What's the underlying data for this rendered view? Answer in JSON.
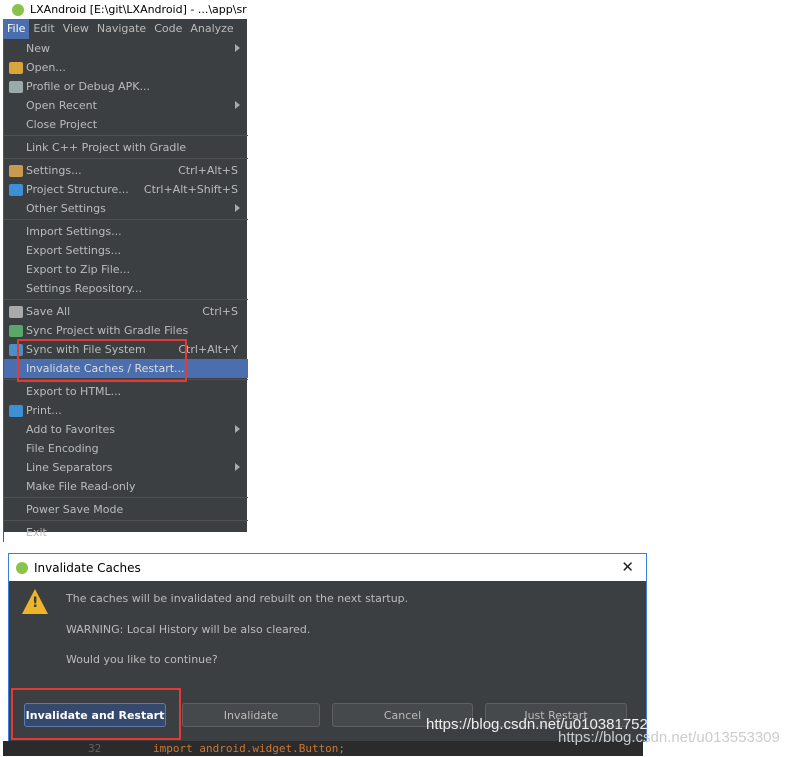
{
  "window": {
    "title": "LXAndroid [E:\\git\\LXAndroid] - ...\\app\\src"
  },
  "menubar": [
    "File",
    "Edit",
    "View",
    "Navigate",
    "Code",
    "Analyze"
  ],
  "file_menu": [
    {
      "label": "New",
      "submenu": true
    },
    {
      "label": "Open...",
      "icon": "folder-icon"
    },
    {
      "label": "Profile or Debug APK...",
      "icon": "apk-icon"
    },
    {
      "label": "Open Recent",
      "submenu": true
    },
    {
      "label": "Close Project",
      "sep_after": true
    },
    {
      "label": "Link C++ Project with Gradle",
      "sep_after": true
    },
    {
      "label": "Settings...",
      "shortcut": "Ctrl+Alt+S",
      "icon": "settings-icon"
    },
    {
      "label": "Project Structure...",
      "shortcut": "Ctrl+Alt+Shift+S",
      "icon": "project-structure-icon"
    },
    {
      "label": "Other Settings",
      "submenu": true,
      "sep_after": true
    },
    {
      "label": "Import Settings..."
    },
    {
      "label": "Export Settings..."
    },
    {
      "label": "Export to Zip File..."
    },
    {
      "label": "Settings Repository...",
      "sep_after": true
    },
    {
      "label": "Save All",
      "shortcut": "Ctrl+S",
      "icon": "save-icon"
    },
    {
      "label": "Sync Project with Gradle Files",
      "icon": "gradle-sync-icon"
    },
    {
      "label": "Sync with File System",
      "shortcut": "Ctrl+Alt+Y",
      "icon": "sync-icon"
    },
    {
      "label": "Invalidate Caches / Restart...",
      "selected": true,
      "sep_after": true
    },
    {
      "label": "Export to HTML..."
    },
    {
      "label": "Print...",
      "icon": "print-icon"
    },
    {
      "label": "Add to Favorites",
      "submenu": true
    },
    {
      "label": "File Encoding"
    },
    {
      "label": "Line Separators",
      "submenu": true
    },
    {
      "label": "Make File Read-only",
      "sep_after": true
    },
    {
      "label": "Power Save Mode",
      "sep_after": true
    },
    {
      "label": "Exit"
    }
  ],
  "dialog": {
    "title": "Invalidate Caches",
    "messages": [
      "The caches will be invalidated and rebuilt on the next startup.",
      "WARNING: Local History will be also cleared.",
      "Would you like to continue?"
    ],
    "buttons": [
      "Invalidate and Restart",
      "Invalidate",
      "Cancel",
      "Just Restart"
    ]
  },
  "code": {
    "line_number": "32",
    "text": "import android.widget.Button;"
  },
  "watermarks": [
    "https://blog.csdn.net/u010381752",
    "https://blog.csdn.net/u013553309"
  ],
  "colors": {
    "highlight": "#4b6eaf",
    "annotation": "#e53935",
    "menu_bg": "#3c3f41"
  }
}
